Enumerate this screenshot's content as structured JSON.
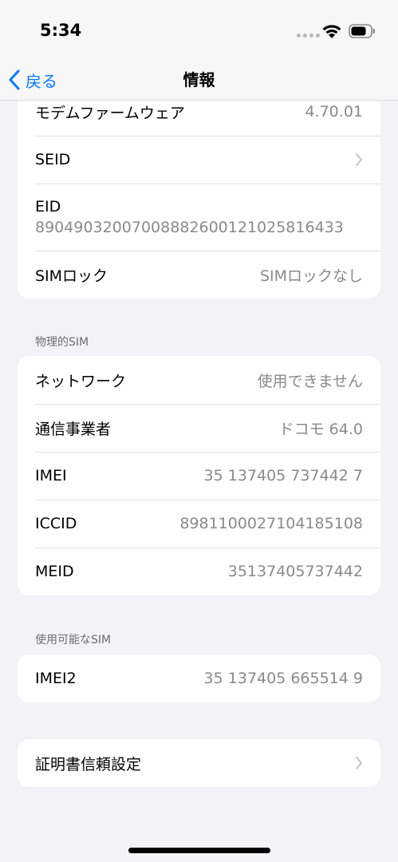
{
  "status_bar": {
    "time": "5:34",
    "icons": [
      "signal-dots-icon",
      "wifi-icon",
      "battery-icon"
    ]
  },
  "nav": {
    "back_label": "戻る",
    "title": "情報",
    "accent_color": "#0a7aff"
  },
  "top_card": {
    "rows": [
      {
        "label": "モデムファームウェア",
        "value": "4.70.01"
      },
      {
        "label": "SEID",
        "value": ""
      },
      {
        "label": "EID",
        "value": "89049032007008882600121025816433"
      },
      {
        "label": "SIMロック",
        "value": "SIMロックなし"
      }
    ]
  },
  "physical_sim": {
    "header": "物理的SIM",
    "rows": [
      {
        "label": "ネットワーク",
        "value": "使用できません"
      },
      {
        "label": "通信事業者",
        "value": "ドコモ 64.0"
      },
      {
        "label": "IMEI",
        "value": "35 137405 737442 7"
      },
      {
        "label": "ICCID",
        "value": "8981100027104185108"
      },
      {
        "label": "MEID",
        "value": "35137405737442"
      }
    ]
  },
  "available_sim": {
    "header": "使用可能なSIM",
    "rows": [
      {
        "label": "IMEI2",
        "value": "35 137405 665514 9"
      }
    ]
  },
  "certificate": {
    "label": "証明書信頼設定"
  }
}
